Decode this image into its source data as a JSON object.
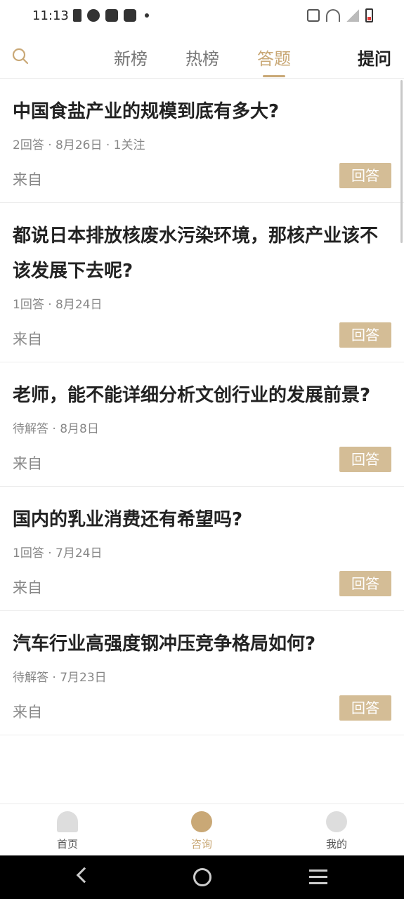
{
  "status": {
    "time": "11:13"
  },
  "nav": {
    "tabs": [
      "新榜",
      "热榜",
      "答题"
    ],
    "active_tab": "答题",
    "ask": "提问"
  },
  "questions": [
    {
      "title": "中国食盐产业的规模到底有多大?",
      "meta": "2回答 · 8月26日 · 1关注",
      "from": "来自",
      "action": "回答"
    },
    {
      "title": "都说日本排放核废水污染环境，那核产业该不该发展下去呢?",
      "meta": "1回答 · 8月24日",
      "from": "来自",
      "action": "回答"
    },
    {
      "title": "老师，能不能详细分析文创行业的发展前景?",
      "meta": "待解答 · 8月8日",
      "from": "来自",
      "action": "回答"
    },
    {
      "title": "国内的乳业消费还有希望吗?",
      "meta": "1回答 · 7月24日",
      "from": "来自",
      "action": "回答"
    },
    {
      "title": "汽车行业高强度钢冲压竞争格局如何?",
      "meta": "待解答 · 7月23日",
      "from": "来自",
      "action": "回答"
    }
  ],
  "bottom_nav": [
    {
      "label": "首页",
      "icon": "home-icon"
    },
    {
      "label": "咨询",
      "icon": "chat-icon"
    },
    {
      "label": "我的",
      "icon": "user-icon"
    }
  ],
  "colors": {
    "accent": "#c9a876",
    "button": "#d4bd96"
  }
}
